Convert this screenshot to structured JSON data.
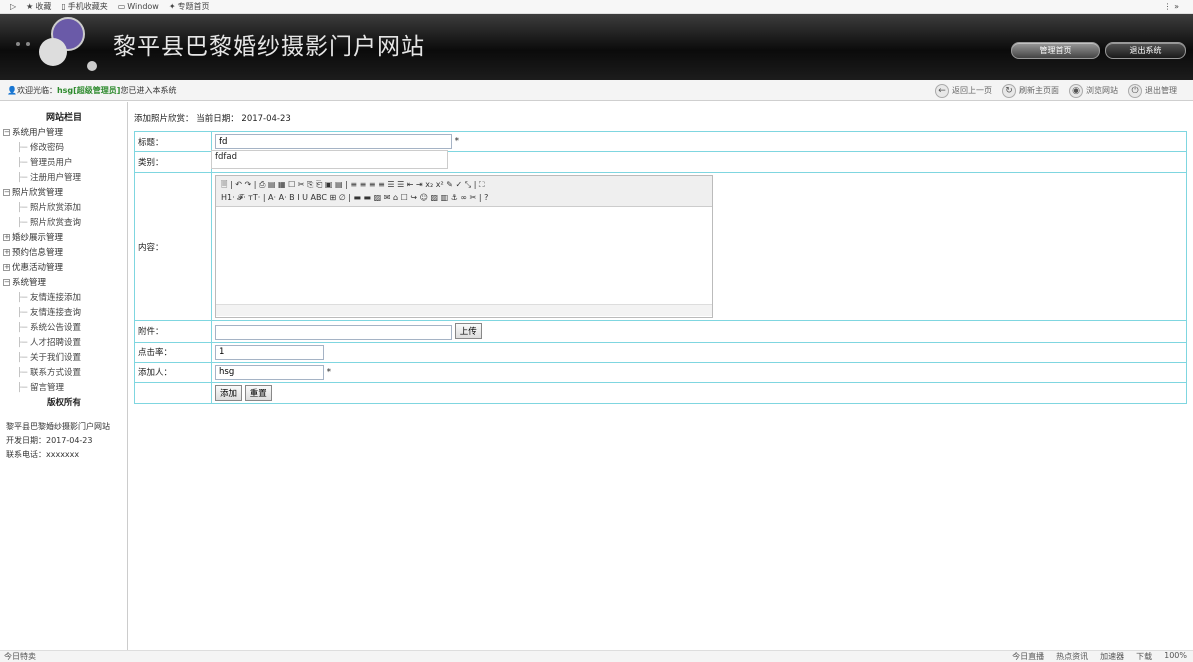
{
  "bookmarks": {
    "items": [
      "收藏",
      "手机收藏夹",
      "Window",
      "专题首页"
    ],
    "menu_icon": "⋮ »"
  },
  "header": {
    "title": "黎平县巴黎婚纱摄影门户网站",
    "home_btn": "管理首页",
    "exit_btn": "退出系统"
  },
  "welcome": {
    "prefix": "欢迎光临：",
    "user": "hsg[超级管理员]",
    "suffix": "您已进入本系统"
  },
  "toolbar": [
    "返回上一页",
    "刷新主页面",
    "浏览网站",
    "退出管理"
  ],
  "sidebar": {
    "title": "网站栏目",
    "tree": [
      {
        "label": "系统用户管理",
        "expanded": true,
        "children": [
          "修改密码",
          "管理员用户",
          "注册用户管理"
        ]
      },
      {
        "label": "照片欣赏管理",
        "expanded": true,
        "children": [
          "照片欣赏添加",
          "照片欣赏查询"
        ]
      },
      {
        "label": "婚纱展示管理",
        "expanded": false,
        "children": []
      },
      {
        "label": "预约信息管理",
        "expanded": false,
        "children": []
      },
      {
        "label": "优惠活动管理",
        "expanded": false,
        "children": []
      },
      {
        "label": "系统管理",
        "expanded": true,
        "children": [
          "友情连接添加",
          "友情连接查询",
          "系统公告设置",
          "人才招聘设置",
          "关于我们设置",
          "联系方式设置",
          "留言管理"
        ]
      }
    ],
    "copyright": "版权所有",
    "info": [
      "黎平县巴黎婚纱摄影门户网站",
      "开发日期：2017-04-23",
      "联系电话：xxxxxxx"
    ]
  },
  "main": {
    "crumb": "添加照片欣赏：  当前日期：  2017-04-23",
    "fields": {
      "title_label": "标题：",
      "title_value": "fd",
      "required": "*",
      "autocomplete": "fdfad",
      "category_label": "类别：",
      "content_label": "内容：",
      "attach_label": "附件：",
      "upload_btn": "上传",
      "hits_label": "点击率：",
      "hits_value": "1",
      "adder_label": "添加人：",
      "adder_value": "hsg"
    },
    "editor": {
      "row1": "🗏 | ↶ ↷ | ⎙ ▤ ▦ ☐ ✂ ⎘ ⎗ ▣ ▤ | ≡ ≡ ≡ ≡ ☰ ☰ ⇤ ⇥ x₂ x² ✎ ✓ ⤡ | ⛶",
      "row2": "H1· 𝓕· тT· | A· A· B I U ABC ⊞ ∅ | ▬ ▬ ▨ ✉ ⌂ ☐ ↪ ☺ ▨ ▥ ⚓ ∞ ✂ | ?"
    },
    "buttons": {
      "add": "添加",
      "reset": "重置"
    }
  },
  "status": {
    "left": "今日特卖",
    "right": [
      "今日直播",
      "热点资讯",
      "加速器",
      "下载",
      "100%"
    ]
  },
  "colors": {
    "accent": "#2e8b2e",
    "border": "#7fd6e0"
  }
}
